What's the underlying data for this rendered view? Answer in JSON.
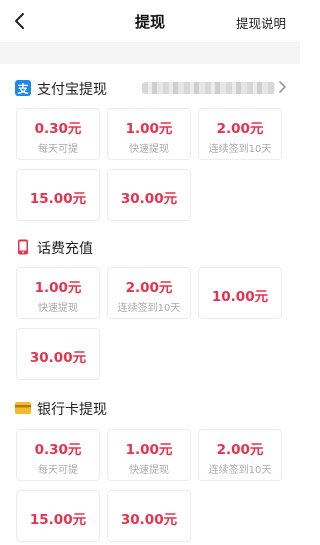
{
  "header": {
    "title": "提现",
    "help_label": "提现说明",
    "back_icon": "back-arrow-icon"
  },
  "sections": [
    {
      "label": "支付宝提现",
      "icon": "alipay-icon",
      "icon_color": "#1e88e5",
      "account_masked": true,
      "options": [
        {
          "amount": "0.30元",
          "note": "每天可提"
        },
        {
          "amount": "1.00元",
          "note": "快速提现"
        },
        {
          "amount": "2.00元",
          "note": "连续签到10天"
        },
        {
          "amount": "15.00元",
          "note": ""
        },
        {
          "amount": "30.00元",
          "note": ""
        }
      ]
    },
    {
      "label": "话费充值",
      "icon": "phone-icon",
      "icon_color": "#e5334e",
      "options": [
        {
          "amount": "1.00元",
          "note": "快速提现"
        },
        {
          "amount": "2.00元",
          "note": "连续签到10天"
        },
        {
          "amount": "10.00元",
          "note": ""
        },
        {
          "amount": "30.00元",
          "note": ""
        }
      ]
    },
    {
      "label": "银行卡提现",
      "icon": "bank-card-icon",
      "icon_color": "#f5b82e",
      "options": [
        {
          "amount": "0.30元",
          "note": "每天可提"
        },
        {
          "amount": "1.00元",
          "note": "快速提现"
        },
        {
          "amount": "2.00元",
          "note": "连续签到10天"
        },
        {
          "amount": "15.00元",
          "note": ""
        },
        {
          "amount": "30.00元",
          "note": ""
        }
      ]
    }
  ],
  "colors": {
    "amount": "#e5334e",
    "note": "#aaaaaa",
    "card_border": "#ededed",
    "divider": "#f5f5f5"
  }
}
